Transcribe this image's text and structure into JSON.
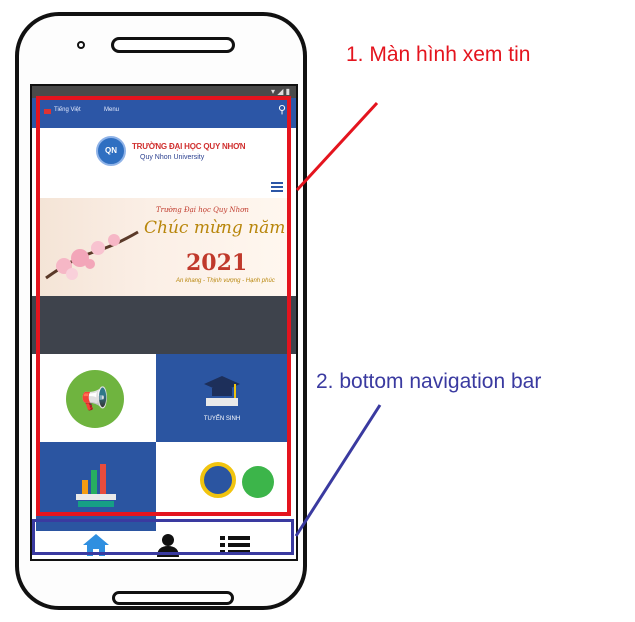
{
  "annotations": {
    "screen_label": "1. Màn hình xem tin",
    "nav_label": "2. bottom navigation bar",
    "colors": {
      "screen": "#e4141e",
      "nav": "#3a3aa0"
    }
  },
  "app": {
    "topbar": {
      "language": "Tiếng Việt",
      "menu": "Menu",
      "search_icon": "search-icon"
    },
    "logo": {
      "seal_text": "QN",
      "name_vi": "TRƯỜNG ĐẠI HỌC QUY NHƠN",
      "name_en": "Quy Nhon University"
    },
    "banner": {
      "small_text": "Trường Đại học Quy Nhơn",
      "greeting": "Chúc mừng năm mới",
      "year": "2021",
      "subtitle": "An khang - Thịnh vượng - Hạnh phúc"
    },
    "tiles": [
      {
        "icon": "megaphone-icon"
      },
      {
        "icon": "graduation-cap-icon",
        "label": "TUYỂN SINH"
      },
      {
        "icon": "books-chart-icon"
      },
      {
        "icon": "target-icon"
      }
    ],
    "bottom_nav": [
      {
        "icon": "home-icon"
      },
      {
        "icon": "user-icon"
      },
      {
        "icon": "list-icon"
      }
    ],
    "brand_color": "#2c56a6"
  }
}
